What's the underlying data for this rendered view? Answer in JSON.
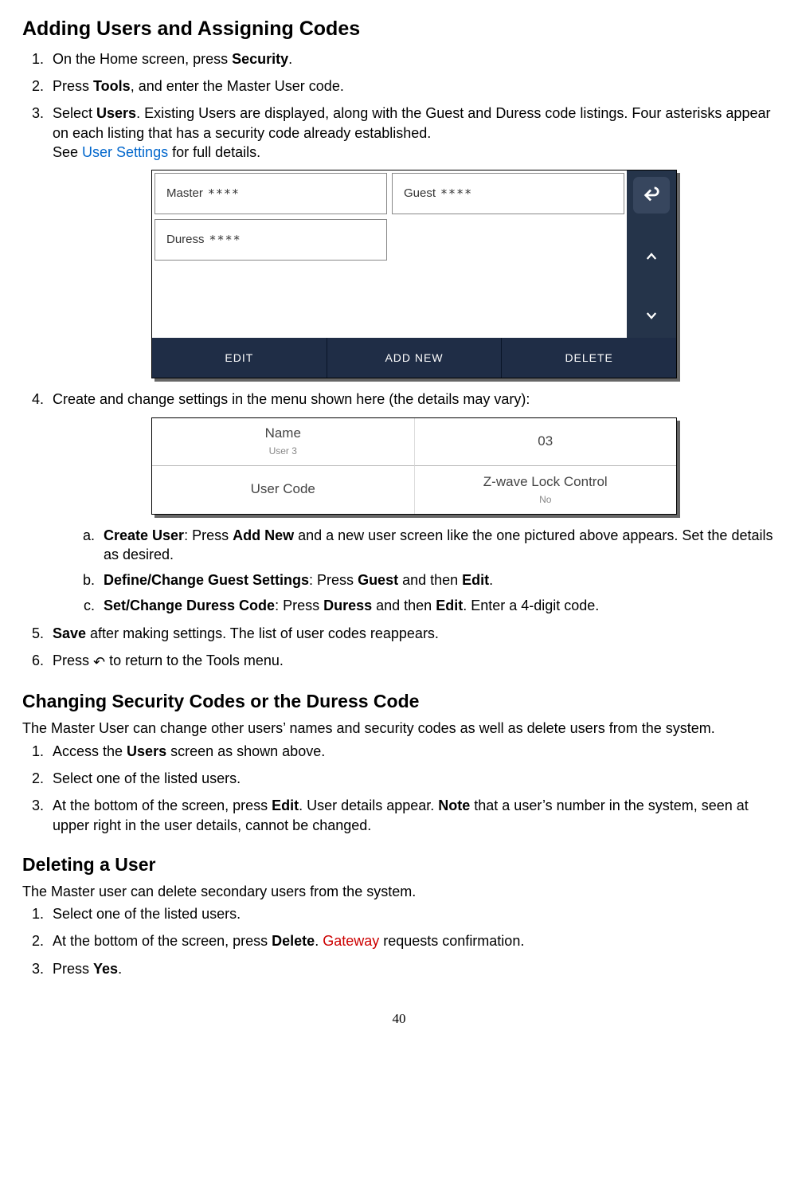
{
  "section1": {
    "heading": "Adding Users and Assigning Codes",
    "step1_pre": "On the Home screen, press ",
    "step1_b": "Security",
    "step1_post": ".",
    "step2_pre": "Press ",
    "step2_b": "Tools",
    "step2_post": ", and enter the Master User code.",
    "step3_pre": "Select ",
    "step3_b": "Users",
    "step3_post": ". Existing Users are displayed, along with the Guest and Duress code listings. Four asterisks appear on each listing that has a security code already established.",
    "step3_see_pre": "See ",
    "step3_link": "User Settings",
    "step3_see_post": " for full details.",
    "step4": "Create and change settings in the menu shown here (the details may vary):",
    "sub_a_b1": "Create User",
    "sub_a_mid": ": Press ",
    "sub_a_b2": "Add New",
    "sub_a_post": " and a new user screen like the one pictured above appears. Set the details as desired.",
    "sub_b_b1": "Define/Change Guest Settings",
    "sub_b_mid": ": Press ",
    "sub_b_b2": "Guest",
    "sub_b_mid2": " and then ",
    "sub_b_b3": "Edit",
    "sub_b_post": ".",
    "sub_c_b1": "Set/Change Duress Code",
    "sub_c_mid": ": Press ",
    "sub_c_b2": "Duress",
    "sub_c_mid2": " and then ",
    "sub_c_b3": "Edit",
    "sub_c_post": ". Enter a 4-digit code.",
    "step5_b": "Save",
    "step5_post": " after making settings. The list of user codes reappears.",
    "step6_pre": "Press ",
    "step6_post": "  to return to the Tools menu."
  },
  "figure1": {
    "cells": {
      "master": "Master",
      "guest": "Guest",
      "duress": "Duress",
      "mask": "****"
    },
    "footer": {
      "edit": "EDIT",
      "add": "ADD NEW",
      "del": "DELETE"
    }
  },
  "figure2": {
    "r1c1_top": "Name",
    "r1c1_sub": "User 3",
    "r1c2": "03",
    "r2c1": "User Code",
    "r2c2_top": "Z-wave Lock Control",
    "r2c2_sub": "No"
  },
  "section2": {
    "heading": "Changing Security Codes or the Duress Code",
    "intro": "The Master User can change other users’ names and security codes as well as delete users from the system.",
    "s1_pre": "Access the ",
    "s1_b": "Users",
    "s1_post": " screen as shown above.",
    "s2": "Select one of the listed users.",
    "s3_pre": "At the bottom of the screen, press ",
    "s3_b1": "Edit",
    "s3_mid": ". User details appear. ",
    "s3_b2": "Note",
    "s3_post": " that a user’s number in the system, seen at upper right in the user details, cannot be changed."
  },
  "section3": {
    "heading": "Deleting a User",
    "intro": "The Master user can delete secondary users from the system.",
    "s1": "Select one of the listed users.",
    "s2_pre": "At the bottom of the screen, press ",
    "s2_b": "Delete",
    "s2_mid": ". ",
    "s2_red": "Gateway",
    "s2_post": " requests confirmation.",
    "s3_pre": "Press ",
    "s3_b": "Yes",
    "s3_post": "."
  },
  "pagenum": "40"
}
